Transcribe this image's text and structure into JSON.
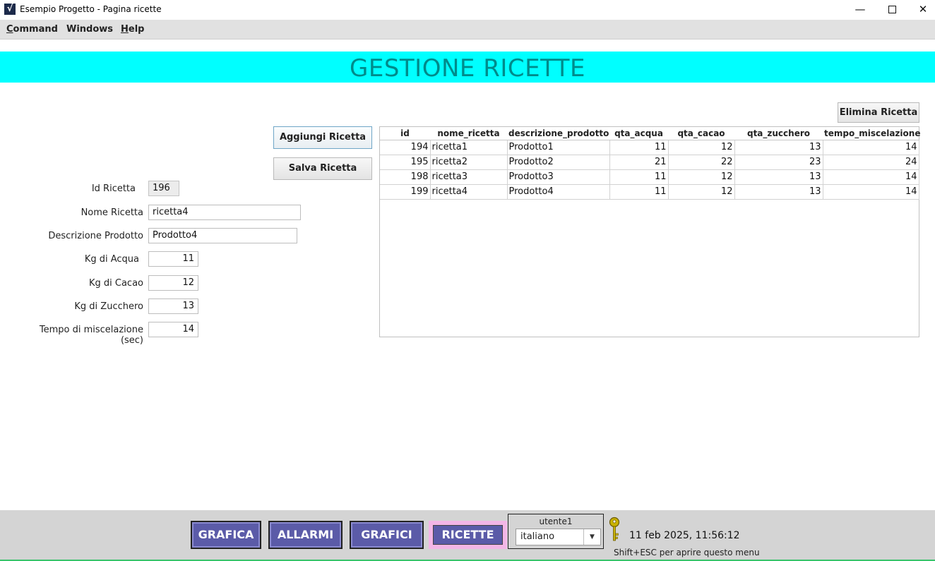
{
  "window": {
    "icon_glyph": "√",
    "title": "Esempio Progetto - Pagina ricette",
    "min_glyph": "—",
    "close_glyph": "✕"
  },
  "menu": {
    "items": [
      {
        "label_first": "C",
        "label_rest": "ommand"
      },
      {
        "label_first": "",
        "label_rest": "Windows"
      },
      {
        "label_first": "H",
        "label_rest": "elp"
      }
    ]
  },
  "header": {
    "title": "GESTIONE RICETTE"
  },
  "buttons": {
    "add": "Aggiungi Ricetta",
    "save": "Salva Ricetta",
    "delete": "Elimina Ricetta"
  },
  "form": {
    "id_label": "Id Ricetta",
    "id_value": "196",
    "name_label": "Nome Ricetta",
    "name_value": "ricetta4",
    "desc_label": "Descrizione Prodotto",
    "desc_value": "Prodotto4",
    "water_label": "Kg di Acqua",
    "water_value": "11",
    "cocoa_label": "Kg di Cacao",
    "cocoa_value": "12",
    "sugar_label": "Kg di Zucchero",
    "sugar_value": "13",
    "time_label": "Tempo di miscelazione (sec)",
    "time_value": "14"
  },
  "table": {
    "columns": [
      "id",
      "nome_ricetta",
      "descrizione_prodotto",
      "qta_acqua",
      "qta_cacao",
      "qta_zucchero",
      "tempo_miscelazione"
    ],
    "rows": [
      [
        "194",
        "ricetta1",
        "Prodotto1",
        "11",
        "12",
        "13",
        "14"
      ],
      [
        "195",
        "ricetta2",
        "Prodotto2",
        "21",
        "22",
        "23",
        "24"
      ],
      [
        "198",
        "ricetta3",
        "Prodotto3",
        "11",
        "12",
        "13",
        "14"
      ],
      [
        "199",
        "ricetta4",
        "Prodotto4",
        "11",
        "12",
        "13",
        "14"
      ]
    ]
  },
  "footer": {
    "nav": [
      "GRAFICA",
      "ALLARMI",
      "GRAFICI",
      "RICETTE"
    ],
    "active_nav": "RICETTE",
    "user": "utente1",
    "language": "italiano",
    "language_arrow": "▼",
    "datetime": "11 feb 2025, 11:56:12",
    "hint": "Shift+ESC per aprire questo menu",
    "key_icon": "key-icon"
  },
  "colors": {
    "header_band": "#00ffff",
    "header_text": "#008b8b",
    "nav_button": "#5b5ba8",
    "nav_active_frame": "#f3b6e6"
  }
}
